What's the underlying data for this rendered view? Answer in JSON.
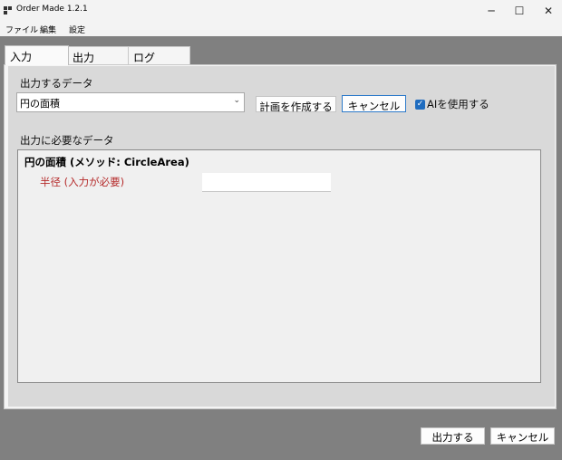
{
  "window": {
    "title": "Order Made 1.2.1",
    "controls": {
      "minimize": "─",
      "maximize": "☐",
      "close": "✕"
    }
  },
  "menu": [
    "ファイル",
    "編集",
    "設定"
  ],
  "tabs": [
    "入力",
    "出力",
    "ログ"
  ],
  "active_tab": "入力",
  "input_panel": {
    "data_label": "出力するデータ",
    "data_select": {
      "value": "円の面積",
      "arrow": "⌄"
    },
    "create_plan_button": "計画を作成する",
    "cancel_button": "キャンセル",
    "use_ai_checkbox": {
      "label": "AIを使用する",
      "checked": true,
      "mark": "✓"
    },
    "required_label": "出力に必要なデータ",
    "method": {
      "title": "円の面積 (メソッド: CircleArea)",
      "params": [
        {
          "label": "半径 (入力が必要)",
          "value": ""
        }
      ]
    }
  },
  "footer": {
    "output_button": "出力する",
    "cancel_button": "キャンセル"
  },
  "colors": {
    "required_param": "#b52a2a",
    "checkbox_accent": "#1f6cbf",
    "background": "#808080"
  }
}
